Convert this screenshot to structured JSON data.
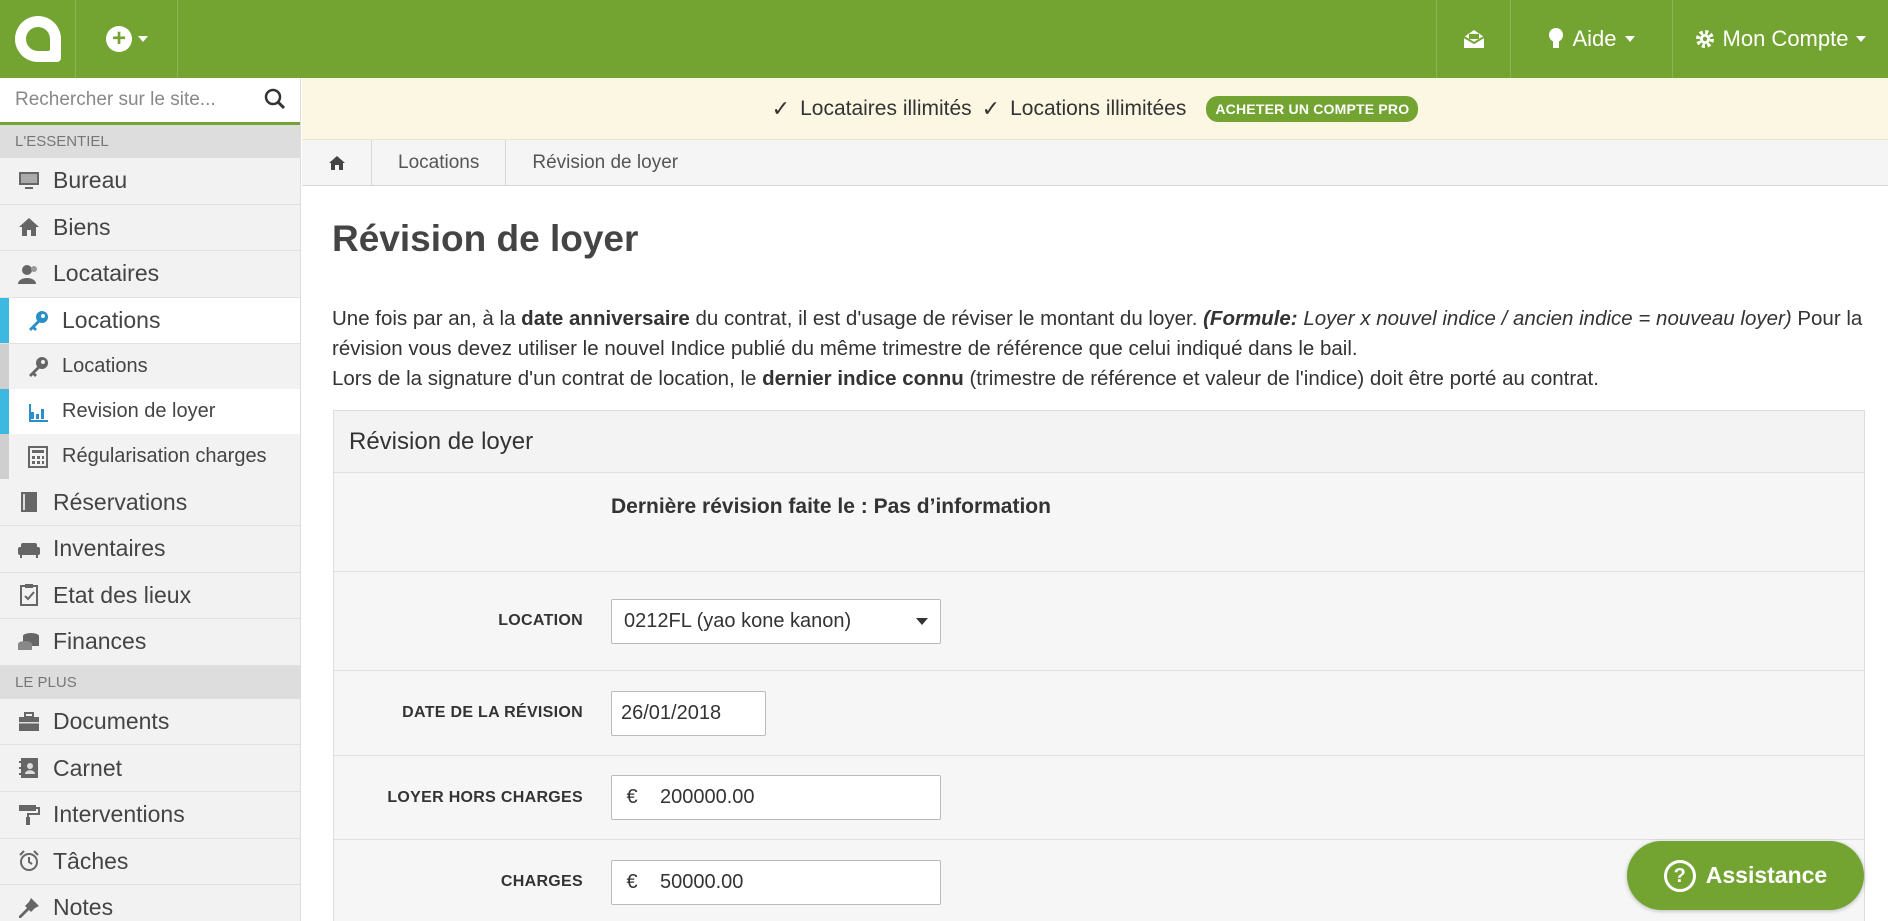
{
  "topbar": {
    "aide_label": "Aide",
    "compte_label": "Mon Compte",
    "brand_color": "#73a432"
  },
  "sidebar": {
    "search_placeholder": "Rechercher sur le site...",
    "section_essentiel": "L'ESSENTIEL",
    "section_plus": "LE PLUS",
    "items_essentiel": [
      {
        "label": "Bureau",
        "icon": "desktop-icon"
      },
      {
        "label": "Biens",
        "icon": "home-icon"
      },
      {
        "label": "Locataires",
        "icon": "users-icon"
      },
      {
        "label": "Locations",
        "icon": "key-icon",
        "active": true
      }
    ],
    "sub_items": [
      {
        "label": "Locations",
        "icon": "key-icon"
      },
      {
        "label": "Revision de loyer",
        "icon": "bar-chart-icon",
        "active": true
      },
      {
        "label": "Régularisation charges",
        "icon": "calculator-icon"
      }
    ],
    "items_after": [
      {
        "label": "Réservations",
        "icon": "book-icon"
      },
      {
        "label": "Inventaires",
        "icon": "sofa-icon"
      },
      {
        "label": "Etat des lieux",
        "icon": "clipboard-check-icon"
      },
      {
        "label": "Finances",
        "icon": "coins-icon"
      }
    ],
    "items_plus": [
      {
        "label": "Documents",
        "icon": "briefcase-icon"
      },
      {
        "label": "Carnet",
        "icon": "address-book-icon"
      },
      {
        "label": "Interventions",
        "icon": "paint-roller-icon"
      },
      {
        "label": "Tâches",
        "icon": "alarm-clock-icon"
      },
      {
        "label": "Notes",
        "icon": "pin-icon"
      }
    ],
    "active_color": "#3db8e0"
  },
  "promo": {
    "item1": "Locataires illimités",
    "item2": "Locations illimitées",
    "badge": "ACHETER UN COMPTE PRO"
  },
  "breadcrumb": {
    "item1": "Locations",
    "item2": "Révision de loyer"
  },
  "page": {
    "title": "Révision de loyer",
    "intro_1a": "Une fois par an, à la ",
    "intro_1b": "date anniversaire",
    "intro_1c": " du contrat, il est d'usage de réviser le montant du loyer. ",
    "intro_1d": "(Formule:",
    "intro_1e": " Loyer x nouvel indice / ancien indice = nouveau loyer)",
    "intro_1f": " Pour la révision vous devez utiliser le nouvel Indice publié du même trimestre de référence que celui indiqué dans le bail.",
    "intro_2a": "Lors de la signature d'un contrat de location, le ",
    "intro_2b": "dernier indice connu",
    "intro_2c": " (trimestre de référence et valeur de l'indice) doit être porté au contrat."
  },
  "panel": {
    "title": "Révision de loyer",
    "last_revision": "Dernière révision faite le : Pas d’information",
    "location_label": "LOCATION",
    "location_value": "0212FL (yao kone kanon)",
    "date_label": "DATE DE LA RÉVISION",
    "date_value": "26/01/2018",
    "loyer_label": "LOYER HORS CHARGES",
    "loyer_currency": "€",
    "loyer_value": "200000.00",
    "charges_label": "CHARGES",
    "charges_currency": "€",
    "charges_value": "50000.00"
  },
  "assistance": {
    "label": "Assistance",
    "icon_char": "?"
  }
}
